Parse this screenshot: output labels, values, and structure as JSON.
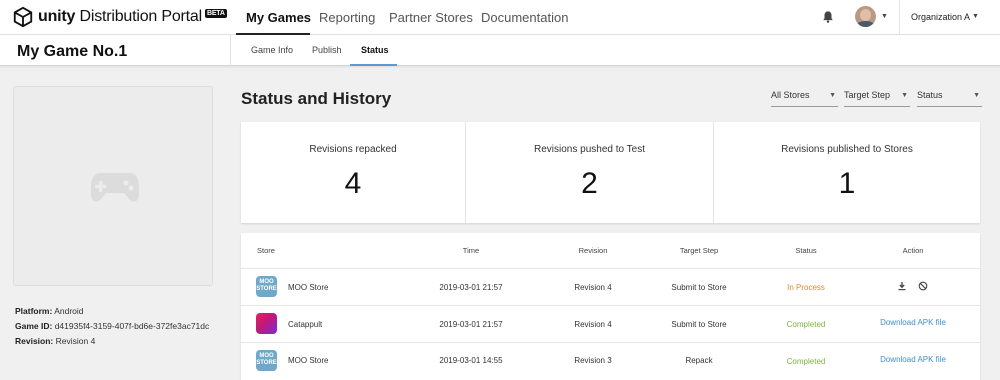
{
  "brand": {
    "name_bold": "unity",
    "name_rest": " Distribution Portal",
    "badge": "BETA"
  },
  "nav": {
    "items": [
      "My Games",
      "Reporting",
      "Partner Stores",
      "Documentation"
    ],
    "active_index": 0
  },
  "account": {
    "organization": "Organization A"
  },
  "game": {
    "title": "My Game No.1",
    "platform_label": "Platform:",
    "platform": "Android",
    "game_id_label": "Game ID:",
    "game_id": "d41935f4-3159-407f-bd6e-372fe3ac71dc",
    "revision_label": "Revision:",
    "revision": "Revision 4"
  },
  "subtabs": {
    "items": [
      "Game Info",
      "Publish",
      "Status"
    ],
    "active_index": 2
  },
  "main": {
    "title": "Status and History",
    "filters": [
      "All Stores",
      "Target Step",
      "Status"
    ]
  },
  "stats": [
    {
      "label": "Revisions repacked",
      "value": "4"
    },
    {
      "label": "Revisions pushed to Test",
      "value": "2"
    },
    {
      "label": "Revisions published to Stores",
      "value": "1"
    }
  ],
  "table": {
    "headers": [
      "Store",
      "Time",
      "Revision",
      "Target Step",
      "Status",
      "Action"
    ],
    "rows": [
      {
        "icon": "moo-store-icon",
        "icon_text": [
          "MOO",
          "STORE"
        ],
        "store": "MOO Store",
        "time": "2019-03-01 21:57",
        "revision": "Revision 4",
        "target": "Submit to Store",
        "status": "In Process",
        "action": ""
      },
      {
        "icon": "catappult-icon",
        "icon_text": [
          "",
          ""
        ],
        "store": "Catappult",
        "time": "2019-03-01 21:57",
        "revision": "Revision 4",
        "target": "Submit to Store",
        "status": "Completed",
        "action": "Download APK file"
      },
      {
        "icon": "moo-store-icon",
        "icon_text": [
          "MOO",
          "STORE"
        ],
        "store": "MOO Store",
        "time": "2019-03-01 14:55",
        "revision": "Revision 3",
        "target": "Repack",
        "status": "Completed",
        "action": "Download APK file"
      }
    ]
  },
  "colors": {
    "in_process": "#e08a2e",
    "completed": "#7cb342",
    "link": "#3f8fd1",
    "tab_underline": "#5b9bd5"
  }
}
